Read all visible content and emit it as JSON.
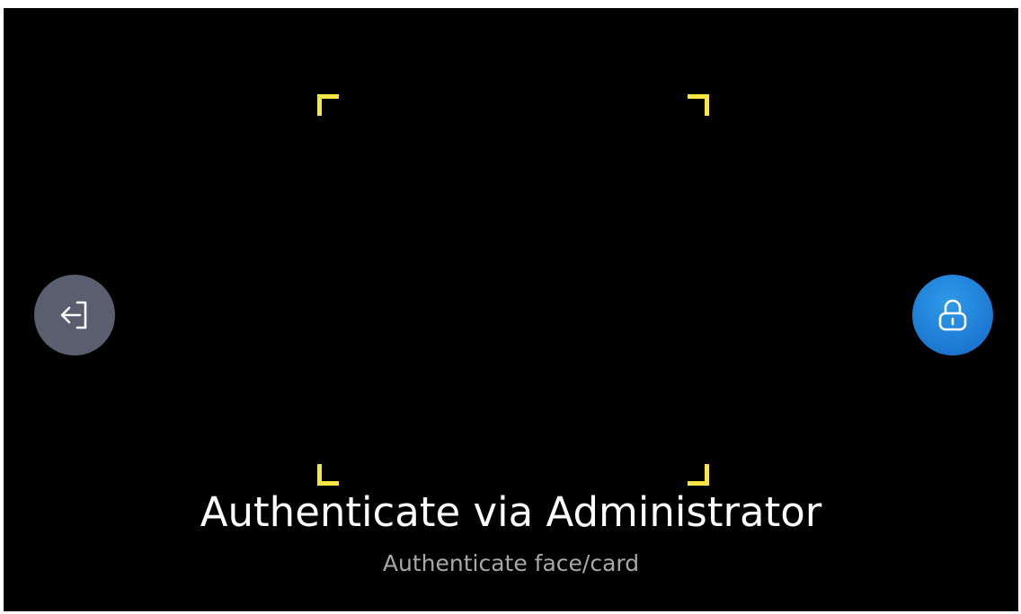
{
  "auth": {
    "title": "Authenticate via Administrator",
    "subtitle": "Authenticate face/card"
  },
  "buttons": {
    "exit_icon": "exit-arrow-icon",
    "lock_icon": "lock-icon"
  },
  "colors": {
    "background": "#000000",
    "frame_corner": "#f5e642",
    "exit_button": "#5a5e6e",
    "lock_button": "#1c78d2",
    "title_text": "#ffffff",
    "subtitle_text": "#a8a8a8"
  }
}
